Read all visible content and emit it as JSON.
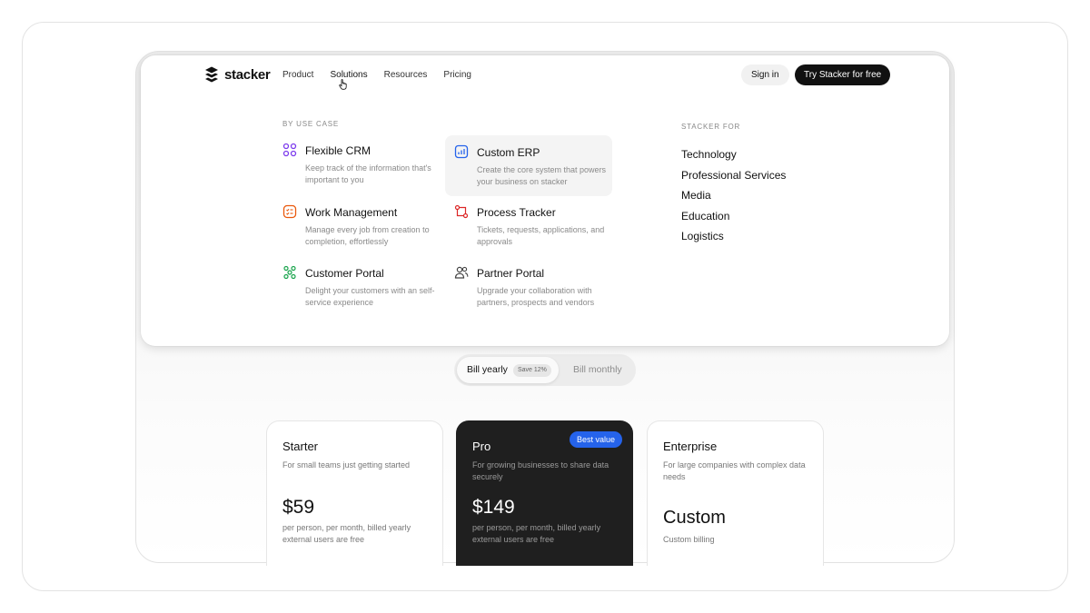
{
  "nav": {
    "logo_text": "stacker",
    "links": [
      "Product",
      "Solutions",
      "Resources",
      "Pricing"
    ],
    "sign_in": "Sign in",
    "try_free": "Try Stacker for free"
  },
  "dropdown": {
    "use_case_label": "BY USE CASE",
    "items": [
      {
        "title": "Flexible CRM",
        "desc": "Keep track of the information that's important to you",
        "icon": "grid-icon"
      },
      {
        "title": "Custom ERP",
        "desc": "Create the core system that powers your business on stacker",
        "icon": "chart-icon"
      },
      {
        "title": "Work Management",
        "desc": "Manage every job from creation to completion, effortlessly",
        "icon": "checklist-icon"
      },
      {
        "title": "Process Tracker",
        "desc": "Tickets, requests, applications, and approvals",
        "icon": "flow-icon"
      },
      {
        "title": "Customer Portal",
        "desc": "Delight your customers with an self-service experience",
        "icon": "network-icon"
      },
      {
        "title": "Partner Portal",
        "desc": "Upgrade your collaboration with partners, prospects and vendors",
        "icon": "users-icon"
      }
    ],
    "stacker_for_label": "STACKER FOR",
    "stacker_for": [
      "Technology",
      "Professional Services",
      "Media",
      "Education",
      "Logistics"
    ]
  },
  "billing": {
    "yearly": "Bill yearly",
    "save": "Save 12%",
    "monthly": "Bill monthly"
  },
  "plans": [
    {
      "name": "Starter",
      "desc": "For small teams just getting started",
      "price": "$59",
      "note": "per person, per month, billed yearly external users are free"
    },
    {
      "name": "Pro",
      "desc": "For growing businesses to share data securely",
      "price": "$149",
      "note": "per person, per month, billed yearly external users are free",
      "badge": "Best value"
    },
    {
      "name": "Enterprise",
      "desc": "For large companies with complex data needs",
      "price": "Custom",
      "note": "Custom billing"
    }
  ],
  "colors": {
    "accent": "#2563eb",
    "dark": "#1f1f1f"
  }
}
